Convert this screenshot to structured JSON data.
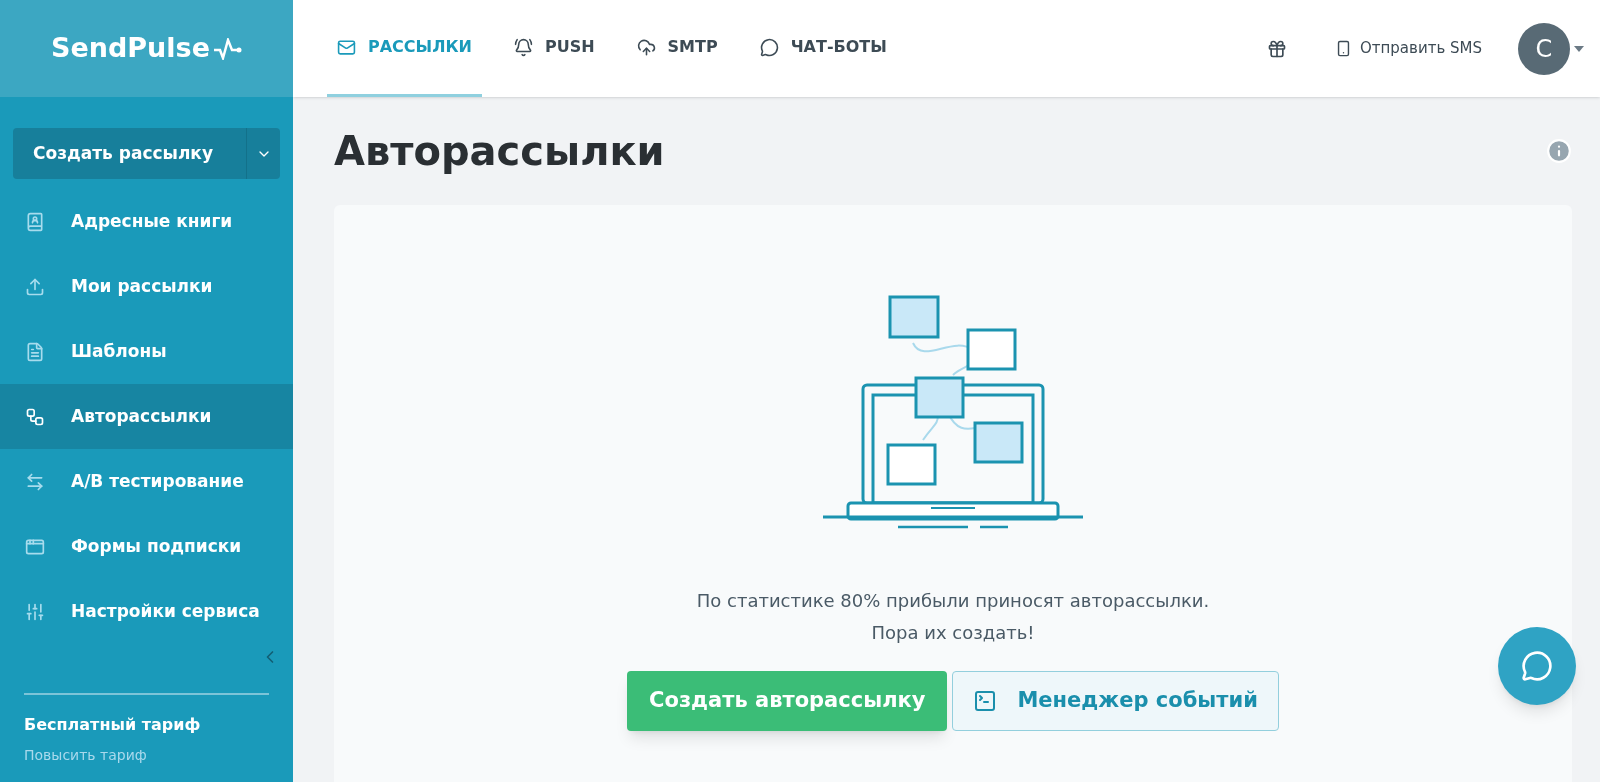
{
  "brand": {
    "logo": "SendPulse"
  },
  "top_tabs": [
    {
      "label": "РАССЫЛКИ",
      "kind": "mail",
      "selected": true
    },
    {
      "label": "PUSH",
      "kind": "bell",
      "selected": false
    },
    {
      "label": "SMTP",
      "kind": "cloud",
      "selected": false
    },
    {
      "label": "ЧАТ-БОТЫ",
      "kind": "chat",
      "selected": false
    }
  ],
  "header_actions": {
    "sms_link": "Отправить SMS",
    "avatar_initial": "C"
  },
  "sidebar": {
    "create_button": "Создать рассылку",
    "items": [
      {
        "label": "Адресные книги",
        "kind": "book",
        "selected": false
      },
      {
        "label": "Мои рассылки",
        "kind": "upload",
        "selected": false
      },
      {
        "label": "Шаблоны",
        "kind": "template",
        "selected": false
      },
      {
        "label": "Авторассылки",
        "kind": "flow",
        "selected": true
      },
      {
        "label": "A/B тестирование",
        "kind": "ab",
        "selected": false
      },
      {
        "label": "Формы подписки",
        "kind": "form",
        "selected": false
      },
      {
        "label": "Настройки сервиса",
        "kind": "sliders",
        "selected": false
      }
    ],
    "plan": {
      "name": "Бесплатный тариф",
      "upgrade_link": "Повысить тариф"
    }
  },
  "page": {
    "title": "Авторассылки",
    "empty_state": {
      "message": "По статистике 80% прибыли приносят авторассылки.",
      "message_line_2": "Пора их создать!",
      "primary_button": "Создать авторассылку",
      "secondary_button": "Менеджер событий"
    }
  }
}
